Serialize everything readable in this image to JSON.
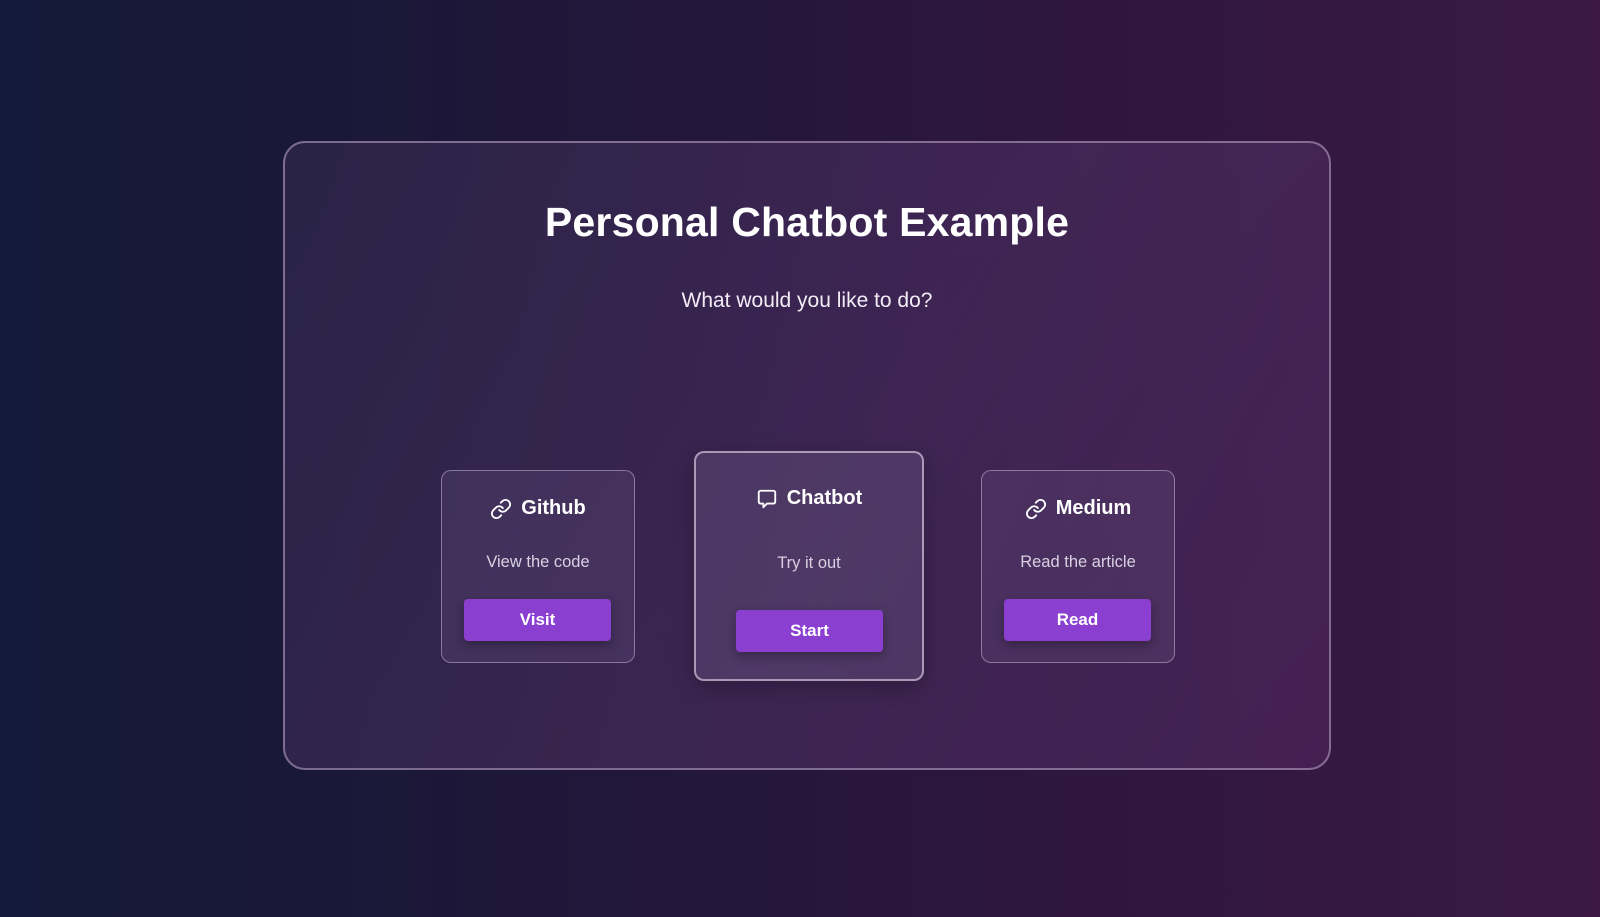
{
  "header": {
    "title": "Personal Chatbot Example",
    "subtitle": "What would you like to do?"
  },
  "cards": [
    {
      "title": "Github",
      "icon": "link-icon",
      "description": "View the code",
      "button_label": "Visit"
    },
    {
      "title": "Chatbot",
      "icon": "chat-bubble-icon",
      "description": "Try it out",
      "button_label": "Start"
    },
    {
      "title": "Medium",
      "icon": "link-icon",
      "description": "Read the article",
      "button_label": "Read"
    }
  ],
  "colors": {
    "accent": "#8a3fd1",
    "background_start": "#141a3b",
    "background_end": "#3b1845"
  }
}
